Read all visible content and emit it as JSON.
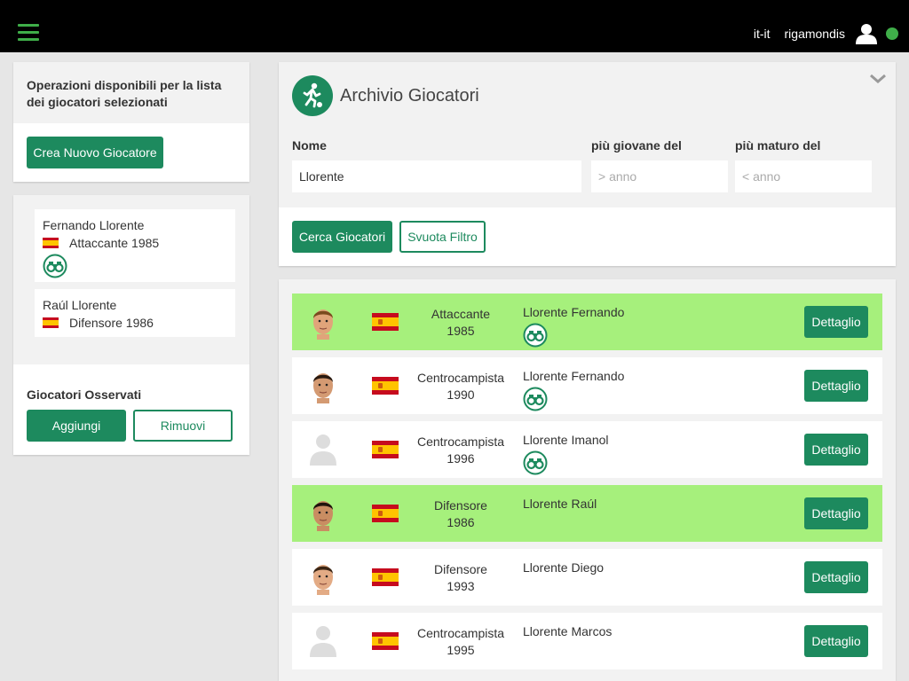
{
  "topbar": {
    "language": "it-it",
    "username": "rigamondis"
  },
  "operations": {
    "title": "Operazioni disponibili per la lista dei giocatori selezionati",
    "create_button": "Crea Nuovo Giocatore"
  },
  "selected": {
    "items": [
      {
        "name": "Fernando Llorente",
        "info": "Attaccante 1985",
        "observed": true
      },
      {
        "name": "Raúl Llorente",
        "info": "Difensore 1986",
        "observed": false
      }
    ],
    "observed_title": "Giocatori Osservati",
    "add_button": "Aggiungi",
    "remove_button": "Rimuovi"
  },
  "archive": {
    "title": "Archivio Giocatori",
    "name_label": "Nome",
    "name_value": "Llorente",
    "younger_label": "più giovane del",
    "younger_placeholder": "> anno",
    "older_label": "più maturo del",
    "older_placeholder": "< anno",
    "search_button": "Cerca Giocatori",
    "clear_button": "Svuota Filtro"
  },
  "results": {
    "detail_label": "Dettaglio",
    "rows": [
      {
        "role": "Attaccante",
        "year": "1985",
        "name": "Llorente Fernando",
        "observed": true,
        "highlight": true,
        "photo": "face-1"
      },
      {
        "role": "Centrocampista",
        "year": "1990",
        "name": "Llorente Fernando",
        "observed": true,
        "highlight": false,
        "photo": "face-2"
      },
      {
        "role": "Centrocampista",
        "year": "1996",
        "name": "Llorente Imanol",
        "observed": true,
        "highlight": false,
        "photo": "placeholder"
      },
      {
        "role": "Difensore",
        "year": "1986",
        "name": "Llorente Raúl",
        "observed": false,
        "highlight": true,
        "photo": "face-3"
      },
      {
        "role": "Difensore",
        "year": "1993",
        "name": "Llorente Diego",
        "observed": false,
        "highlight": false,
        "photo": "face-4"
      },
      {
        "role": "Centrocampista",
        "year": "1995",
        "name": "Llorente Marcos",
        "observed": false,
        "highlight": false,
        "photo": "placeholder"
      }
    ]
  },
  "colors": {
    "brand_green": "#1d8a5e",
    "highlight_green": "#a6f07c",
    "status_green": "#3fae49"
  }
}
